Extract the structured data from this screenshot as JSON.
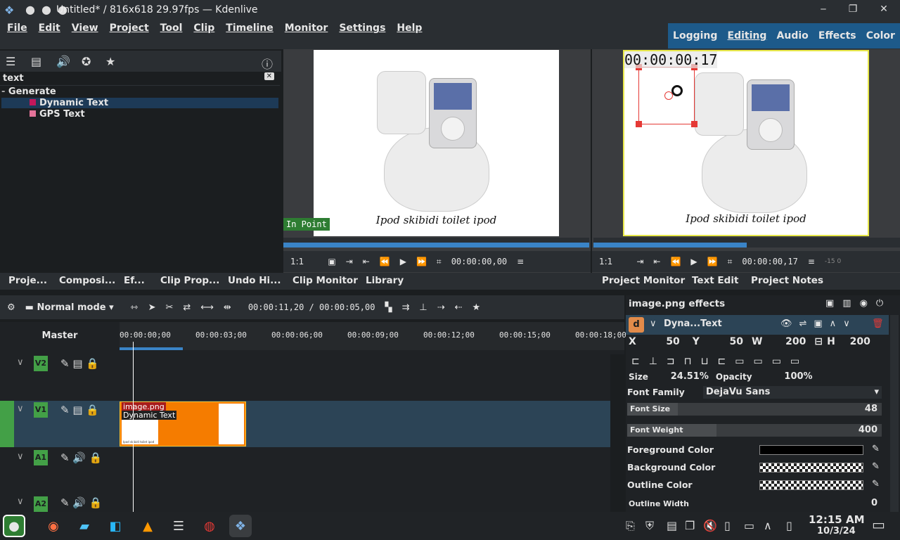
{
  "window": {
    "title": "Untitled* / 816x618 29.97fps — Kdenlive",
    "dots": "● ● ●"
  },
  "menus": [
    "File",
    "Edit",
    "View",
    "Project",
    "Tool",
    "Clip",
    "Timeline",
    "Monitor",
    "Settings",
    "Help"
  ],
  "layouts": [
    "Logging",
    "Editing",
    "Audio",
    "Effects",
    "Color"
  ],
  "effects_panel": {
    "search": "text",
    "tree": {
      "group": "Generate",
      "items": [
        "Dynamic Text",
        "GPS Text"
      ]
    }
  },
  "clip_monitor": {
    "caption": "Ipod skibidi toilet ipod",
    "in_point": "In Point",
    "zoom": "1:1",
    "timecode": "00:00:00,00"
  },
  "project_monitor": {
    "caption": "Ipod skibidi toilet ipod",
    "overlay_tc": "00:00:00:17",
    "zoom": "1:1",
    "timecode": "00:00:00,17",
    "side_value": "-15  0"
  },
  "tabs": [
    "Proje...",
    "Composi...",
    "Ef...",
    "Clip Prop...",
    "Undo Hi...",
    "Clip Monitor",
    "Library",
    "Project Monitor",
    "Text Edit",
    "Project Notes"
  ],
  "timeline": {
    "mode": "Normal mode",
    "timecode": "00:00:11,20 / 00:00:05,00",
    "master": "Master",
    "ruler": [
      "00:00:00;00",
      "00:00:03;00",
      "00:00:06;00",
      "00:00:09;00",
      "00:00:12;00",
      "00:00:15;00",
      "00:00:18;00"
    ],
    "tracks": [
      "V2",
      "V1",
      "A1",
      "A2"
    ],
    "clip": {
      "name": "image.png",
      "effect": "Dynamic Text",
      "thumb_caption": "Ipod skibidi toilet ipod"
    }
  },
  "effect_stack": {
    "title": "image.png effects",
    "effect_name": "Dyna...Text",
    "badge": "d",
    "x_label": "X",
    "x": "50",
    "y_label": "Y",
    "y": "50",
    "w_label": "W",
    "w": "200",
    "h_label": "H",
    "h": "200",
    "size_label": "Size",
    "size": "24.51%",
    "opacity_label": "Opacity",
    "opacity": "100%",
    "font_family_label": "Font Family",
    "font_family": "DejaVu Sans",
    "font_size_label": "Font Size",
    "font_size": "48",
    "font_size_level": 0.2,
    "font_weight_label": "Font Weight",
    "font_weight": "400",
    "font_weight_level": 0.35,
    "fg_label": "Foreground Color",
    "bg_label": "Background Color",
    "outline_label": "Outline Color",
    "outline_width_label": "Outline Width",
    "outline_width": "0"
  },
  "taskbar": {
    "time": "12:15 AM",
    "date": "10/3/24"
  },
  "colors": {
    "accent": "#1d5a8a",
    "track_green": "#43a047",
    "clip_orange": "#f57c00",
    "selection": "#1d3a57"
  }
}
